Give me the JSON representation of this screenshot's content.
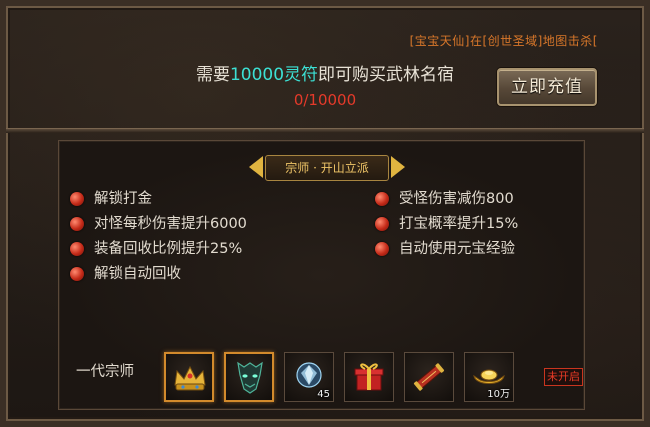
{
  "ticker": "[宝宝天仙]在[创世圣域]地图击杀[",
  "requirement": {
    "prefix": "需要",
    "highlight": "10000灵符",
    "suffix": "即可购买武林名宿",
    "progress": "0/10000"
  },
  "recharge_button": "立即充值",
  "title": "宗师 · 开山立派",
  "perks_left": [
    "解锁打金",
    "对怪每秒伤害提升6000",
    "装备回收比例提升25%",
    "解锁自动回收"
  ],
  "perks_right": [
    "受怪伤害减伤800",
    "打宝概率提升15%",
    "自动使用元宝经验"
  ],
  "rewards": {
    "label": "一代宗师",
    "items": [
      {
        "icon": "crown-icon",
        "count": ""
      },
      {
        "icon": "demon-mask-icon",
        "count": ""
      },
      {
        "icon": "diamond-icon",
        "count": "45"
      },
      {
        "icon": "gift-box-icon",
        "count": ""
      },
      {
        "icon": "scroll-icon",
        "count": ""
      },
      {
        "icon": "gold-ingot-icon",
        "count": "10万"
      }
    ],
    "status": "未开启"
  },
  "colors": {
    "highlight": "#3ce0d4",
    "progress": "#e53a2a",
    "ticker": "#d8772a",
    "gold_border": "#d28a2c"
  }
}
